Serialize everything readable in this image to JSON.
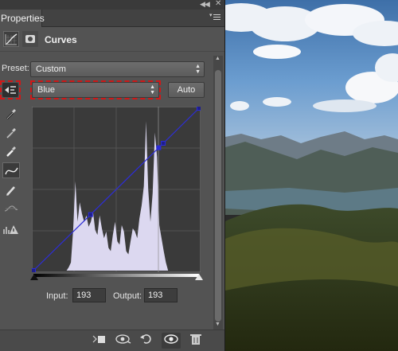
{
  "tabs": {
    "active_label": "Properties"
  },
  "header": {
    "title": "Curves",
    "curves_icon": "curves-adjustment-icon",
    "mask_icon": "layer-mask-icon"
  },
  "preset": {
    "label": "Preset:",
    "value": "Custom"
  },
  "channel": {
    "value": "Blue"
  },
  "auto_button": {
    "label": "Auto"
  },
  "tools": [
    "target-adjust-icon",
    "black-point-eyedropper-icon",
    "gray-point-eyedropper-icon",
    "white-point-eyedropper-icon",
    "curve-points-icon",
    "pencil-icon",
    "smooth-icon",
    "clipping-warning-icon"
  ],
  "io": {
    "input_label": "Input:",
    "input_value": "193",
    "output_label": "Output:",
    "output_value": "193"
  },
  "curve": {
    "color": "#2b2bd8",
    "points": [
      [
        0,
        0
      ],
      [
        88,
        88
      ],
      [
        193,
        193
      ],
      [
        200,
        200
      ],
      [
        255,
        255
      ]
    ]
  },
  "histogram_color": "#dcd8f0",
  "bottom_bar": [
    "clip-to-layer-icon",
    "view-previous-state-icon",
    "reset-icon",
    "visibility-eye-icon",
    "trash-icon"
  ],
  "colors": {
    "panel": "#535353",
    "highlight": "#d01818"
  }
}
